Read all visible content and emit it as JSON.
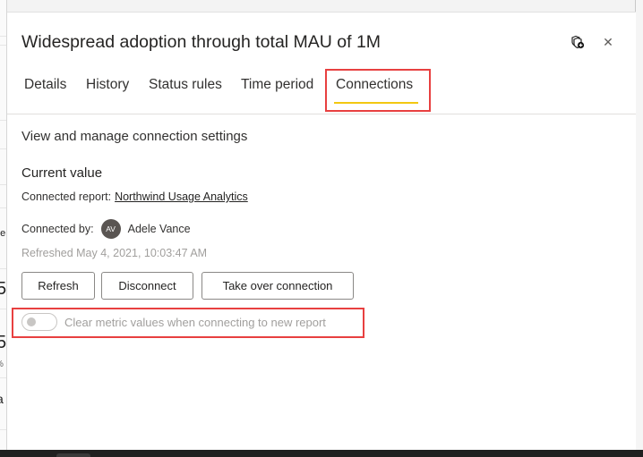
{
  "panel": {
    "title": "Widespread adoption through total MAU of 1M",
    "header_icons": {
      "connect": "connect-shield-add-icon",
      "close": "close-icon",
      "close_glyph": "✕"
    }
  },
  "tabs": [
    {
      "label": "Details",
      "active": false
    },
    {
      "label": "History",
      "active": false
    },
    {
      "label": "Status rules",
      "active": false
    },
    {
      "label": "Time period",
      "active": false
    },
    {
      "label": "Connections",
      "active": true
    }
  ],
  "accent_color": "#f2c811",
  "highlight_color": "#e84040",
  "connections": {
    "section_title": "View and manage connection settings",
    "current_value_heading": "Current value",
    "connected_report_label": "Connected report:",
    "connected_report_name": "Northwind Usage Analytics",
    "connected_by_label": "Connected by:",
    "user_initials": "AV",
    "user_name": "Adele Vance",
    "refreshed": "Refreshed May 4, 2021, 10:03:47 AM",
    "buttons": {
      "refresh": "Refresh",
      "disconnect": "Disconnect",
      "take_over": "Take over connection"
    },
    "toggle": {
      "label": "Clear metric values when connecting to new report",
      "on": false,
      "disabled": true
    }
  },
  "background_fragments": [
    "ue",
    "5",
    "5",
    "%",
    "a"
  ]
}
